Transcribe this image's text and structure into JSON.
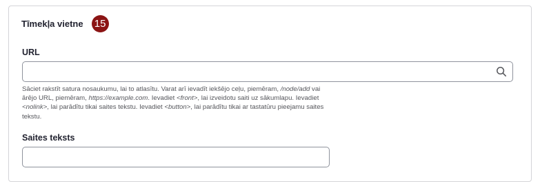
{
  "section": {
    "title": "Tīmekļa vietne",
    "step_number": "15"
  },
  "url_field": {
    "label": "URL",
    "value": "",
    "placeholder": "",
    "help": {
      "part1": "Sāciet rakstīt satura nosaukumu, lai to atlasītu. Varat arī ievadīt iekšējo ceļu, piemēram, ",
      "example1": "/node/add",
      "part2": " vai ārējo URL, piemēram, ",
      "example2": "https://example.com",
      "part3": ". Ievadiet ",
      "example3": "<front>",
      "part4": ", lai izveidotu saiti uz sākumlapu. Ievadiet ",
      "example4": "<nolink>",
      "part5": ", lai parādītu tikai saites tekstu. Ievadiet ",
      "example5": "<button>",
      "part6": ", lai parādītu tikai ar tastatūru pieejamu saites tekstu."
    }
  },
  "link_text_field": {
    "label": "Saites teksts",
    "value": "",
    "placeholder": ""
  },
  "icons": {
    "search": "search-icon"
  },
  "colors": {
    "badge": "#8b1414",
    "border": "#8e929c"
  }
}
